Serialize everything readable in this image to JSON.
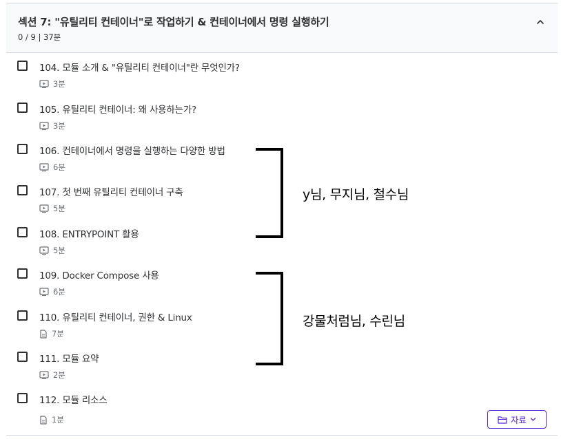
{
  "section": {
    "title": "섹션 7: \"유틸리티 컨테이너\"로 작업하기 & 컨테이너에서 명령 실행하기",
    "meta": "0 / 9 | 37분"
  },
  "lectures": [
    {
      "title": "104. 모듈 소개 & \"유틸리티 컨테이너\"란 무엇인가?",
      "duration": "3분",
      "icon": "video-icon"
    },
    {
      "title": "105. 유틸리티 컨테이너: 왜 사용하는가?",
      "duration": "3분",
      "icon": "video-icon"
    },
    {
      "title": "106. 컨테이너에서 명령을 실행하는 다양한 방법",
      "duration": "6분",
      "icon": "video-icon"
    },
    {
      "title": "107. 첫 번째 유틸리티 컨테이너 구축",
      "duration": "5분",
      "icon": "video-icon"
    },
    {
      "title": "108. ENTRYPOINT 활용",
      "duration": "5분",
      "icon": "video-icon"
    },
    {
      "title": "109. Docker Compose 사용",
      "duration": "6분",
      "icon": "video-icon"
    },
    {
      "title": "110. 유틸리티 컨테이너, 권한 & Linux",
      "duration": "7분",
      "icon": "document-icon"
    },
    {
      "title": "111. 모듈 요약",
      "duration": "2분",
      "icon": "video-icon"
    },
    {
      "title": "112. 모듈 리소스",
      "duration": "1분",
      "icon": "document-icon"
    }
  ],
  "annotations": [
    {
      "text": "y님, 무지님, 철수님"
    },
    {
      "text": "강물처럼님, 수린님"
    }
  ],
  "resources_button": {
    "label": "자료"
  },
  "colors": {
    "accent": "#5624d0",
    "header_bg": "#f7f9fa",
    "text": "#2d2f31",
    "muted": "#6a6f73"
  }
}
